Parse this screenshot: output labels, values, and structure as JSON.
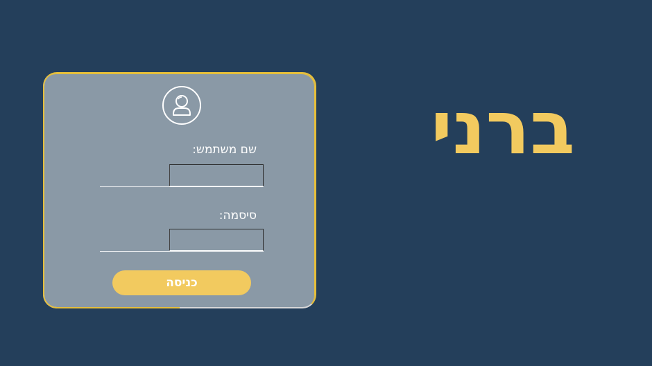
{
  "brand": {
    "title": "ברני"
  },
  "login": {
    "username_label": "שם משתמש:",
    "username_value": "",
    "password_label": "סיסמה:",
    "password_value": "",
    "submit_label": "כניסה"
  },
  "icons": {
    "avatar": "user-icon"
  },
  "colors": {
    "background": "#243f5b",
    "accent": "#f2ca5f",
    "card": "#8a99a6",
    "card_border": "#e6bf3b"
  }
}
